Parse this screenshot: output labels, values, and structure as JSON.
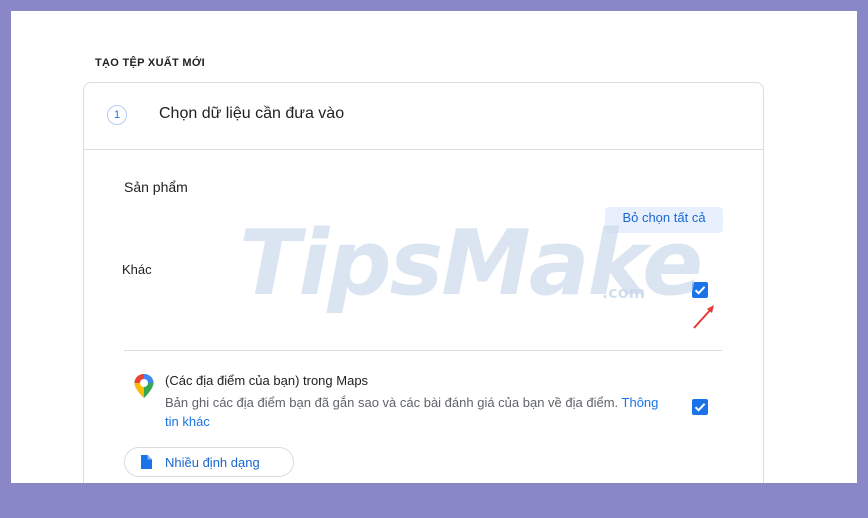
{
  "page": {
    "title": "TẠO TỆP XUẤT MỚI"
  },
  "step": {
    "number": "1",
    "label": "Chọn dữ liệu cần đưa vào"
  },
  "products": {
    "section_label": "Sản phẩm",
    "deselect_all_label": "Bỏ chọn tất cả",
    "other_label": "Khác"
  },
  "maps": {
    "title": "(Các địa điểm của bạn) trong Maps",
    "description": "Bản ghi các địa điểm bạn đã gắn sao và các bài đánh giá của bạn về địa điểm.",
    "more_info_link": "Thông tin khác",
    "format_button": "Nhiều định dạng",
    "icon": "maps-pin-icon"
  },
  "watermark": {
    "main": "TipsMake",
    "suffix": ".com"
  },
  "colors": {
    "accent": "#1a73e8",
    "frame_border": "#8a87c9",
    "annotation_arrow": "#e53935"
  }
}
